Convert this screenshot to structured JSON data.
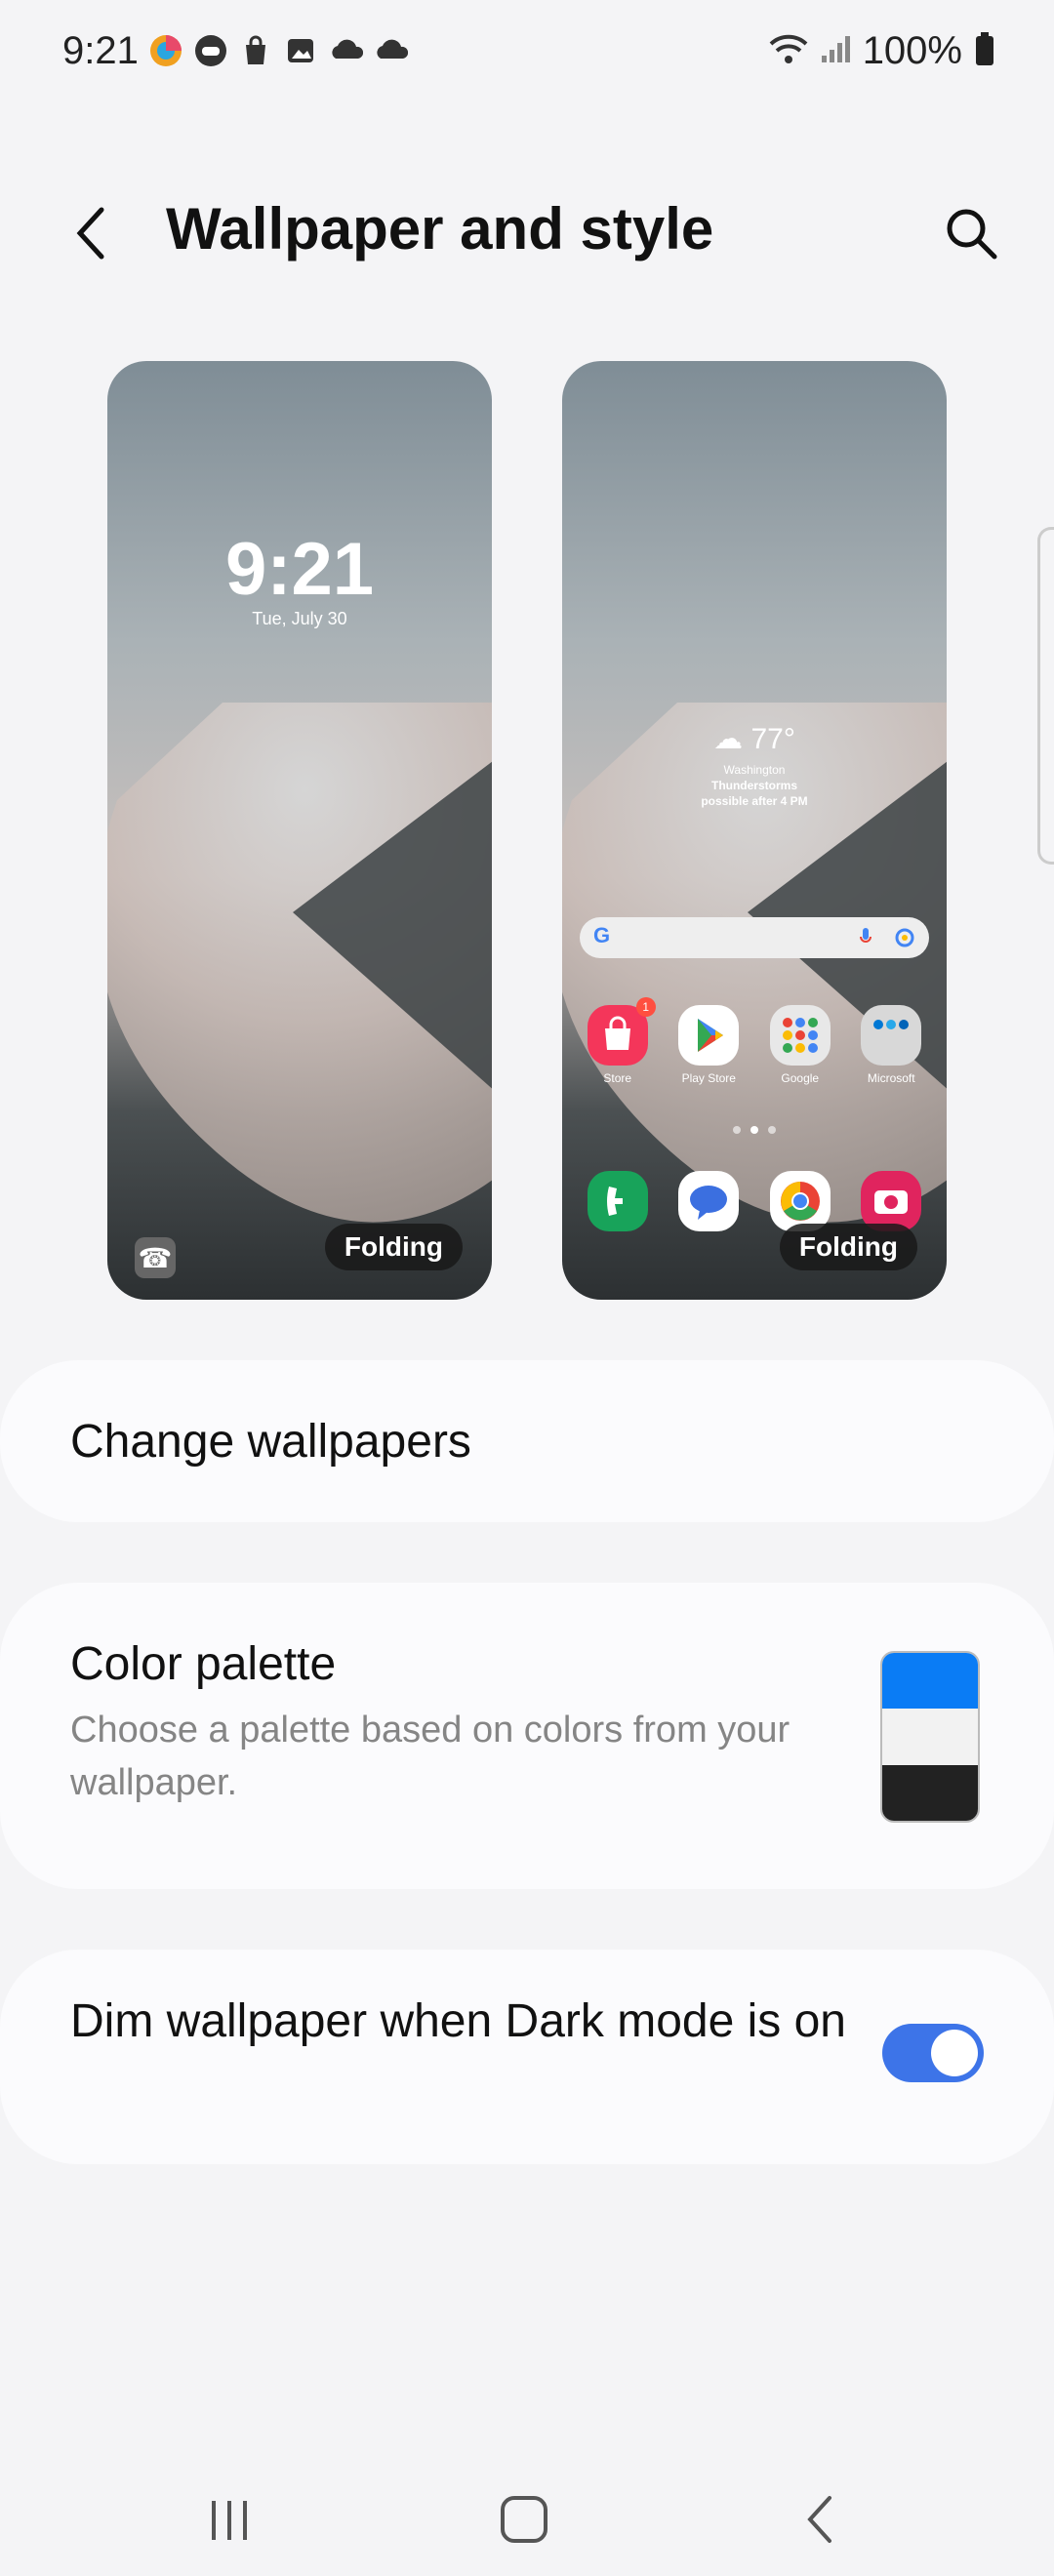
{
  "status_bar": {
    "time": "9:21",
    "battery_text": "100%"
  },
  "header": {
    "title": "Wallpaper and style"
  },
  "lock_preview": {
    "time": "9:21",
    "date": "Tue, July 30",
    "badge": "Folding"
  },
  "home_preview": {
    "weather_temp": "77°",
    "weather_location": "Washington",
    "weather_condition": "Thunderstorms",
    "weather_note": "possible after 4 PM",
    "badge": "Folding",
    "apps": [
      {
        "label": "Store",
        "color": "#f4365a"
      },
      {
        "label": "Play Store",
        "color": "#ffffff"
      },
      {
        "label": "Google",
        "color": "#e8e8e8"
      },
      {
        "label": "Microsoft",
        "color": "#d8d8d8"
      }
    ],
    "store_badge": "1"
  },
  "settings": {
    "change_wallpapers": "Change wallpapers",
    "color_palette_title": "Color palette",
    "color_palette_sub": "Choose a palette based on colors from your wallpaper.",
    "palette_colors": [
      "#0a7cf5",
      "#f2f2f2",
      "#222222"
    ],
    "dim_title": "Dim wallpaper when Dark mode is on",
    "dim_enabled": true
  },
  "colors": {
    "accent": "#3d74e8",
    "background": "#f4f4f6"
  }
}
